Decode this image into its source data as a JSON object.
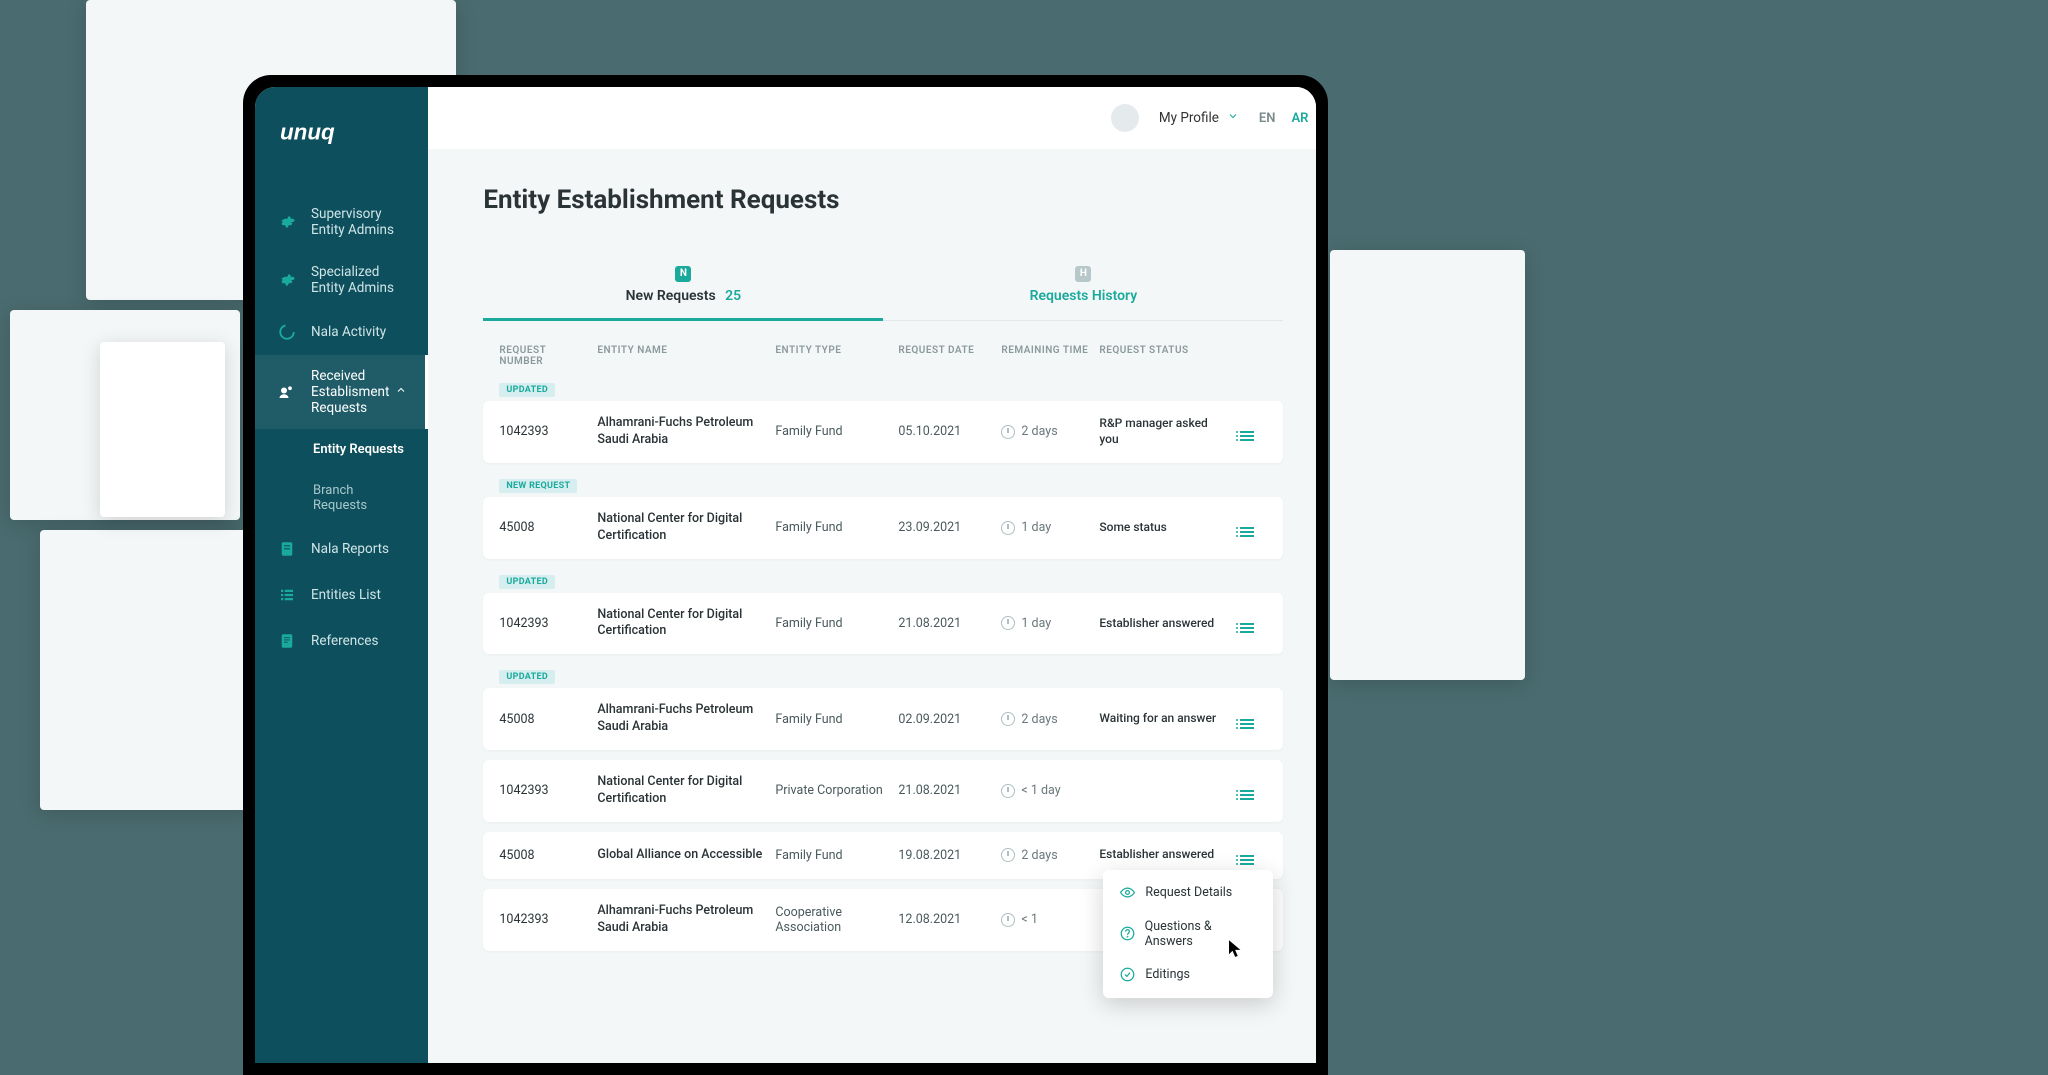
{
  "brand": "unuq",
  "header": {
    "profile_label": "My Profile",
    "lang_en": "EN",
    "lang_ar": "AR"
  },
  "sidebar": {
    "items": [
      {
        "label": "Supervisory Entity Admins"
      },
      {
        "label": "Specialized Entity Admins"
      },
      {
        "label": "Nala Activity"
      },
      {
        "label": "Received Establisment Requests"
      },
      {
        "label": "Entity Requests"
      },
      {
        "label": "Branch Requests"
      },
      {
        "label": "Nala Reports"
      },
      {
        "label": "Entities List"
      },
      {
        "label": "References"
      }
    ]
  },
  "page": {
    "title": "Entity Establishment Requests"
  },
  "tabs": {
    "new": {
      "label": "New Requests",
      "count": "25",
      "badge": "N"
    },
    "history": {
      "label": "Requests History",
      "badge": "H"
    }
  },
  "table": {
    "head": {
      "number": "REQUEST NUMBER",
      "name": "ENTITY NAME",
      "type": "ENTITY TYPE",
      "date": "REQUEST DATE",
      "time": "REMAINING TIME",
      "status": "REQUEST STATUS"
    },
    "rows": [
      {
        "badge": "UPDATED",
        "badgeClass": "updated",
        "num": "1042393",
        "name": "Alhamrani-Fuchs Petroleum Saudi Arabia",
        "type": "Family Fund",
        "date": "05.10.2021",
        "time": "2 days",
        "status": "R&P manager asked you"
      },
      {
        "badge": "NEW REQUEST",
        "badgeClass": "new",
        "num": "45008",
        "name": "National Center for Digital Certification",
        "type": "Family Fund",
        "date": "23.09.2021",
        "time": "1 day",
        "status": "Some status"
      },
      {
        "badge": "UPDATED",
        "badgeClass": "updated",
        "num": "1042393",
        "name": "National Center for Digital Certification",
        "type": "Family Fund",
        "date": "21.08.2021",
        "time": "1 day",
        "status": "Establisher answered"
      },
      {
        "badge": "UPDATED",
        "badgeClass": "updated",
        "num": "45008",
        "name": "Alhamrani-Fuchs Petroleum Saudi Arabia",
        "type": "Family Fund",
        "date": "02.09.2021",
        "time": "2 days",
        "status": "Waiting for an answer"
      },
      {
        "badge": "",
        "badgeClass": "",
        "num": "1042393",
        "name": "National Center for Digital Certification",
        "type": "Private Corporation",
        "date": "21.08.2021",
        "time": "< 1 day",
        "status": ""
      },
      {
        "badge": "",
        "badgeClass": "",
        "num": "45008",
        "name": "Global Alliance on Accessible",
        "type": "Family Fund",
        "date": "19.08.2021",
        "time": "2 days",
        "status": "Establisher answered"
      },
      {
        "badge": "",
        "badgeClass": "",
        "num": "1042393",
        "name": "Alhamrani-Fuchs Petroleum Saudi Arabia",
        "type": "Cooperative Association",
        "date": "12.08.2021",
        "time": "< 1",
        "status": ""
      }
    ]
  },
  "dropdown": {
    "details": "Request Details",
    "qa": "Questions & Answers",
    "editings": "Editings"
  },
  "colors": {
    "primary": "#1aaa9c",
    "sidebar": "#0d4f5c",
    "bg": "#f4f7f8"
  }
}
